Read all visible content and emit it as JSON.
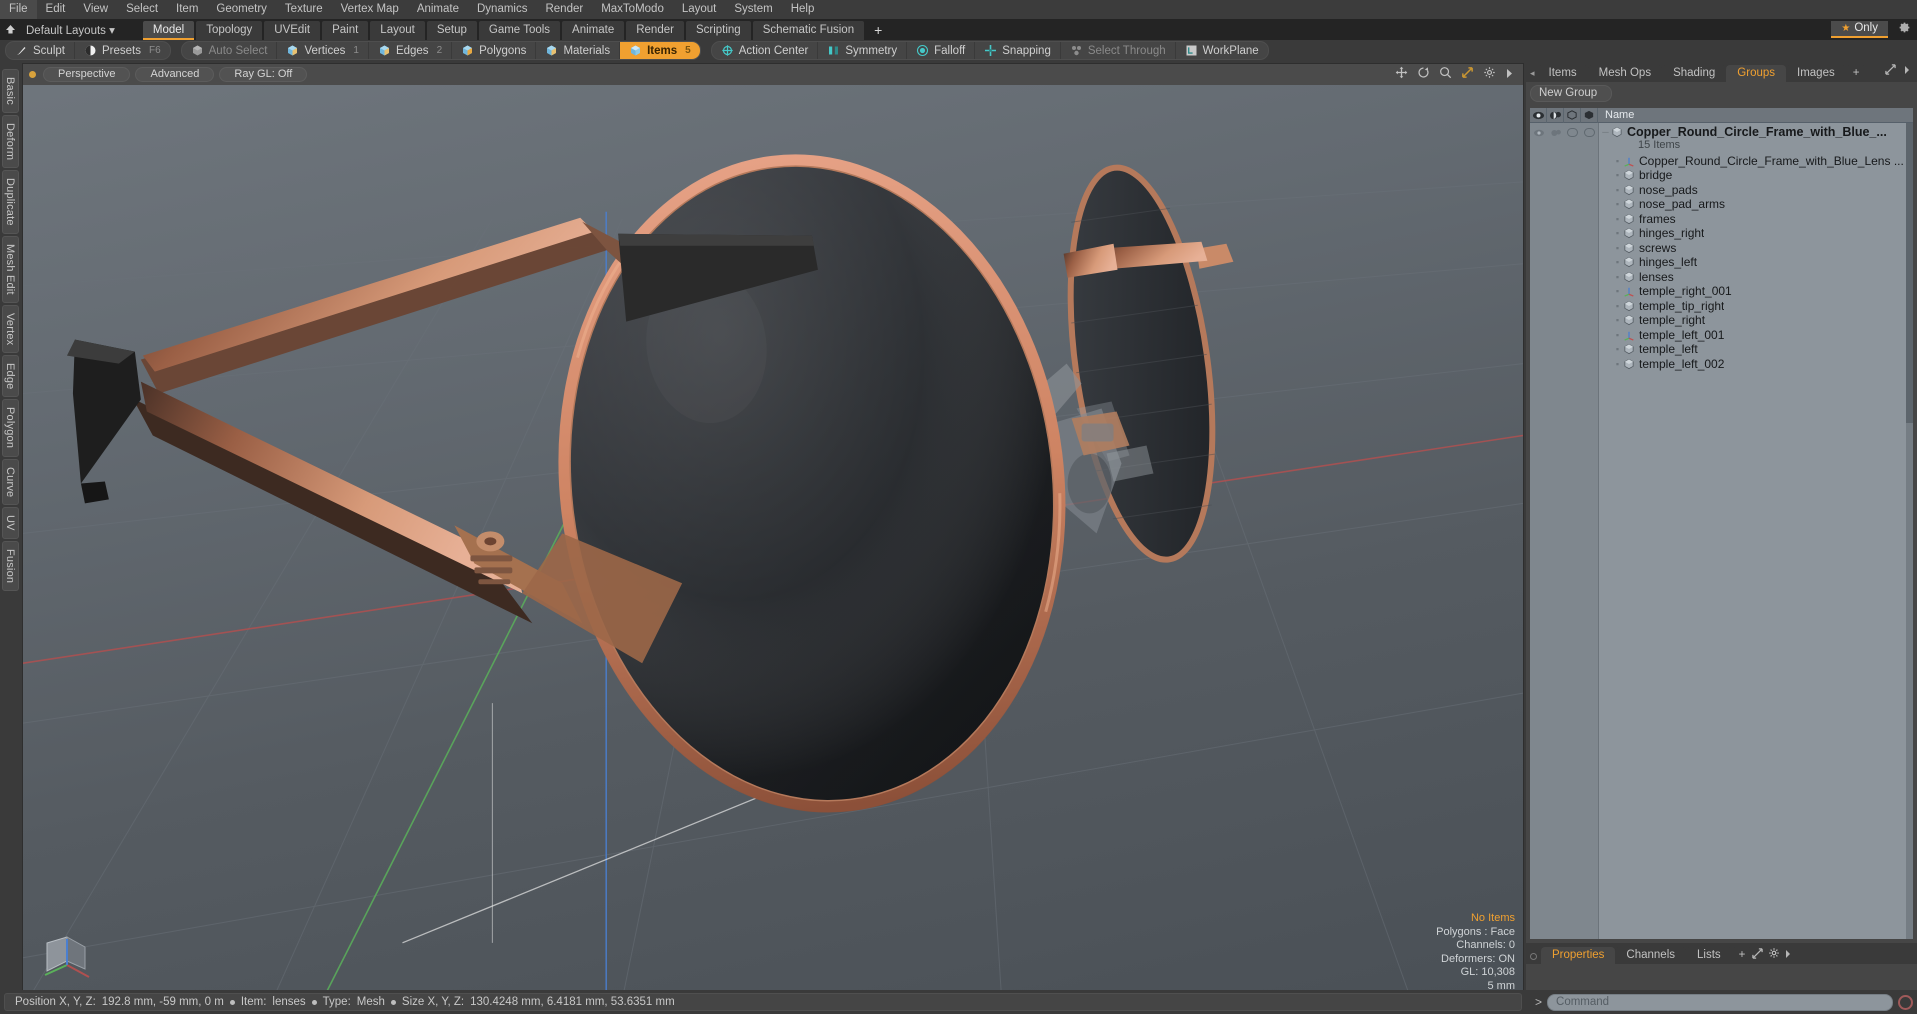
{
  "app": {
    "name": "Modo",
    "accent": "#f0a030",
    "panel_bg": "#3a3a3a",
    "list_bg": "#8d959c"
  },
  "menubar": {
    "items": [
      "File",
      "Edit",
      "View",
      "Select",
      "Item",
      "Geometry",
      "Texture",
      "Vertex Map",
      "Animate",
      "Dynamics",
      "Render",
      "MaxToModo",
      "Layout",
      "System",
      "Help"
    ]
  },
  "layoutbar": {
    "preset_label": "Default Layouts",
    "tabs": [
      "Model",
      "Topology",
      "UVEdit",
      "Paint",
      "Layout",
      "Setup",
      "Game Tools",
      "Animate",
      "Render",
      "Scripting",
      "Schematic Fusion"
    ],
    "active_tab": "Model",
    "add_label": "+",
    "only_label": "Only",
    "gear_icon": "gear-icon",
    "home_icon": "home-icon"
  },
  "modebar": {
    "group1": [
      {
        "label": "Sculpt",
        "icon": "brush-icon",
        "state": "normal"
      },
      {
        "label": "Presets",
        "icon": "sphere-icon",
        "state": "normal",
        "hotkey": "F6"
      }
    ],
    "group2": [
      {
        "label": "Auto Select",
        "icon": "cube-gray-icon",
        "state": "dim"
      },
      {
        "label": "Vertices",
        "icon": "cube-blue-icon",
        "state": "normal",
        "num": "1"
      },
      {
        "label": "Edges",
        "icon": "cube-blue-icon",
        "state": "normal",
        "num": "2"
      },
      {
        "label": "Polygons",
        "icon": "cube-orange-icon",
        "state": "normal",
        "num": ""
      },
      {
        "label": "Materials",
        "icon": "cube-blue-icon",
        "state": "normal",
        "num": ""
      },
      {
        "label": "Items",
        "icon": "cube-blue-icon",
        "state": "active",
        "num": "5"
      }
    ],
    "group3": [
      {
        "label": "Action Center",
        "icon": "crosshair-circle-icon",
        "state": "normal"
      },
      {
        "label": "Symmetry",
        "icon": "symmetry-icon",
        "state": "normal"
      },
      {
        "label": "Falloff",
        "icon": "falloff-icon",
        "state": "normal"
      },
      {
        "label": "Snapping",
        "icon": "snap-cross-icon",
        "state": "normal"
      },
      {
        "label": "Select Through",
        "icon": "select-through-icon",
        "state": "dim"
      },
      {
        "label": "WorkPlane",
        "icon": "workplane-icon",
        "state": "normal"
      }
    ]
  },
  "left_strip": {
    "tabs": [
      "Basic",
      "Deform",
      "Duplicate",
      "Mesh Edit",
      "Vertex",
      "Edge",
      "Polygon",
      "Curve",
      "UV",
      "Fusion"
    ]
  },
  "viewport": {
    "view_mode": "Perspective",
    "shading_mode": "Advanced",
    "ray_gl": "Ray GL: Off",
    "header_icons": [
      "move-icon",
      "rotate-icon",
      "zoom-icon",
      "fit-icon",
      "gear-icon",
      "chevron-right-icon"
    ],
    "stats": {
      "selection": "No Items",
      "polygons": "Polygons : Face",
      "channels": "Channels: 0",
      "deformers": "Deformers: ON",
      "gl": "GL: 10,308",
      "scale": "5 mm"
    },
    "model": "copper-round-circle-frame-sunglasses"
  },
  "right_panel": {
    "tabs": [
      "Items",
      "Mesh Ops",
      "Shading",
      "Groups",
      "Images"
    ],
    "active_tab": "Groups",
    "add_label": "+",
    "new_group_label": "New Group",
    "column_headers": {
      "name": "Name",
      "icons": [
        "eye-icon",
        "shade-icon",
        "lock-outline-icon",
        "lock-solid-icon"
      ]
    },
    "group": {
      "name": "Copper_Round_Circle_Frame_with_Blue_...",
      "item_count": "15 Items",
      "icon": "mesh-icon"
    },
    "items": [
      {
        "name": "Copper_Round_Circle_Frame_with_Blue_Lens ...",
        "icon": "locator-icon"
      },
      {
        "name": "bridge",
        "icon": "mesh-icon"
      },
      {
        "name": "nose_pads",
        "icon": "mesh-icon"
      },
      {
        "name": "nose_pad_arms",
        "icon": "mesh-icon"
      },
      {
        "name": "frames",
        "icon": "mesh-icon"
      },
      {
        "name": "hinges_right",
        "icon": "mesh-icon"
      },
      {
        "name": "screws",
        "icon": "mesh-icon"
      },
      {
        "name": "hinges_left",
        "icon": "mesh-icon"
      },
      {
        "name": "lenses",
        "icon": "mesh-icon"
      },
      {
        "name": "temple_right_001",
        "icon": "locator-icon"
      },
      {
        "name": "temple_tip_right",
        "icon": "mesh-icon"
      },
      {
        "name": "temple_right",
        "icon": "mesh-icon"
      },
      {
        "name": "temple_left_001",
        "icon": "locator-icon"
      },
      {
        "name": "temple_left",
        "icon": "mesh-icon"
      },
      {
        "name": "temple_left_002",
        "icon": "mesh-icon"
      }
    ]
  },
  "bottom_right_panel": {
    "tabs": [
      "Properties",
      "Channels",
      "Lists"
    ],
    "active_tab": "Properties",
    "add_label": "+"
  },
  "statusbar": {
    "position_label": "Position X, Y, Z:",
    "position_value": "192.8 mm, -59 mm, 0 m",
    "item_label": "Item:",
    "item_value": "lenses",
    "type_label": "Type:",
    "type_value": "Mesh",
    "size_label": "Size X, Y, Z:",
    "size_value": "130.4248 mm, 6.4181 mm, 53.6351 mm"
  },
  "command_bar": {
    "prompt": ">",
    "placeholder": "Command",
    "record_icon": "record-circle-icon"
  }
}
